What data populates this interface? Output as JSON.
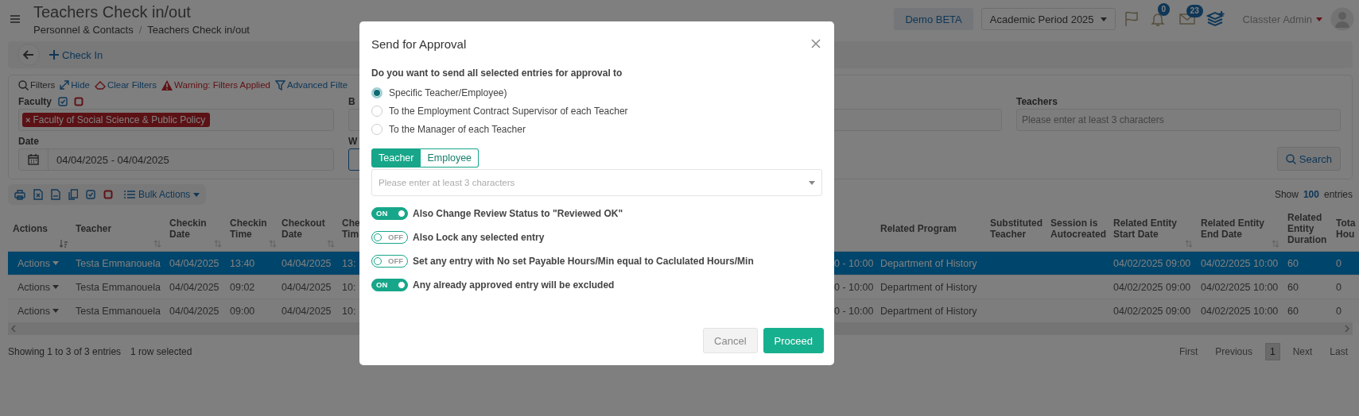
{
  "header": {
    "title": "Teachers Check in/out",
    "breadcrumb": [
      "Personnel & Contacts",
      "Teachers Check in/out"
    ],
    "breadcrumb_separator": "/",
    "env_button": "Demo BETA",
    "period_select": "Academic Period 2025",
    "notifications_badge": "0",
    "messages_badge": "23",
    "user": "Classter Admin"
  },
  "toolbar": {
    "action": "Check In"
  },
  "filter_bar": [
    {
      "kind": "search",
      "label": "Filters"
    },
    {
      "kind": "hide",
      "label": "Hide"
    },
    {
      "kind": "clear",
      "label": "Clear Filters"
    },
    {
      "kind": "warning",
      "label": "Warning: Filters Applied"
    },
    {
      "kind": "advanced",
      "label": "Advanced Filte"
    }
  ],
  "filters": {
    "faculty": {
      "label": "Faculty",
      "tags": [
        "Faculty of Social Science & Public Policy"
      ],
      "tag_remove_mark": "×"
    },
    "column_2_label": "B",
    "teachers": {
      "label": "Teachers",
      "placeholder": "Please enter at least 3 characters"
    },
    "date": {
      "label": "Date",
      "value": "04/04/2025 - 04/04/2025"
    },
    "column_2_row_2_label": "W",
    "search_button": "Search"
  },
  "table_toolbar": {
    "bulk_actions": "Bulk Actions",
    "show_label": "Show",
    "show_count": "100",
    "show_suffix": "entries"
  },
  "table": {
    "columns": [
      {
        "label": "Actions",
        "sortable": true,
        "sorted": true
      },
      {
        "label": "Teacher",
        "sortable": true,
        "sorted": false
      },
      {
        "label": "Checkin Date",
        "sortable": true,
        "sorted": false
      },
      {
        "label": "Checkin Time",
        "sortable": true,
        "sorted": false
      },
      {
        "label": "Checkout Date",
        "sortable": true,
        "sorted": false
      },
      {
        "label": "Che Tim"
      },
      {},
      {
        "label": "Related Program"
      },
      {
        "label": "Substituted Teacher"
      },
      {
        "label": "Session is Autocreated"
      },
      {
        "label": "Related Entity Start Date",
        "sortable": true,
        "sorted": false
      },
      {
        "label": "Related Entity End Date",
        "sortable": true,
        "sorted": false
      },
      {
        "label": "Related Entity Duration"
      },
      {
        "label": "Tota Hou"
      }
    ],
    "rows": [
      {
        "selected": true,
        "cells": [
          "Actions",
          "Testa Emmanouela",
          "04/04/2025",
          "13:40",
          "04/04/2025",
          "13:",
          "0 - 10:00",
          "Department of History",
          null,
          null,
          "04/02/2025 09:00",
          "04/02/2025 10:00",
          "60",
          "0"
        ]
      },
      {
        "selected": false,
        "cells": [
          "Actions",
          "Testa Emmanouela",
          "04/04/2025",
          "09:02",
          "04/04/2025",
          "10:",
          "0 - 10:00",
          "Department of History",
          null,
          null,
          "04/02/2025 09:00",
          "04/02/2025 10:00",
          "60",
          "0"
        ]
      },
      {
        "selected": false,
        "cells": [
          "Actions",
          "Testa Emmanouela",
          "04/04/2025",
          "09:00",
          "04/04/2025",
          "10:",
          "0 - 10:00",
          "Department of History",
          null,
          null,
          "04/02/2025 09:00",
          "04/02/2025 10:00",
          "60",
          "0"
        ]
      }
    ]
  },
  "footer": {
    "info": "Showing 1 to 3 of 3 entries",
    "selection": "1 row selected",
    "pages": [
      {
        "label": "First",
        "selected": false
      },
      {
        "label": "Previous",
        "selected": false
      },
      {
        "label": "1",
        "selected": true
      },
      {
        "label": "Next",
        "selected": false
      },
      {
        "label": "Last",
        "selected": false
      }
    ]
  },
  "modal": {
    "title": "Send for Approval",
    "question": "Do you want to send all selected entries for approval to",
    "options": [
      {
        "label": "Specific Teacher/Employee)",
        "selected": true
      },
      {
        "label": "To the Employment Contract Supervisor of each Teacher",
        "selected": false
      },
      {
        "label": "To the Manager of each Teacher",
        "selected": false
      }
    ],
    "segments": [
      {
        "label": "Teacher",
        "selected": true
      },
      {
        "label": "Employee",
        "selected": false
      }
    ],
    "select_placeholder": "Please enter at least 3 characters",
    "toggles": [
      {
        "on": true,
        "switch_text": "ON",
        "label": "Also Change Review Status to \"Reviewed OK\""
      },
      {
        "on": false,
        "switch_text": "OFF",
        "label": "Also Lock any selected entry"
      },
      {
        "on": false,
        "switch_text": "OFF",
        "label": "Set any entry with No set Payable Hours/Min equal to Caclulated Hours/Min"
      },
      {
        "on": true,
        "switch_text": "ON",
        "label": "Any already approved entry will be excluded"
      }
    ],
    "buttons": [
      {
        "kind": "cancel",
        "label": "Cancel"
      },
      {
        "kind": "primary",
        "label": "Proceed"
      }
    ]
  }
}
